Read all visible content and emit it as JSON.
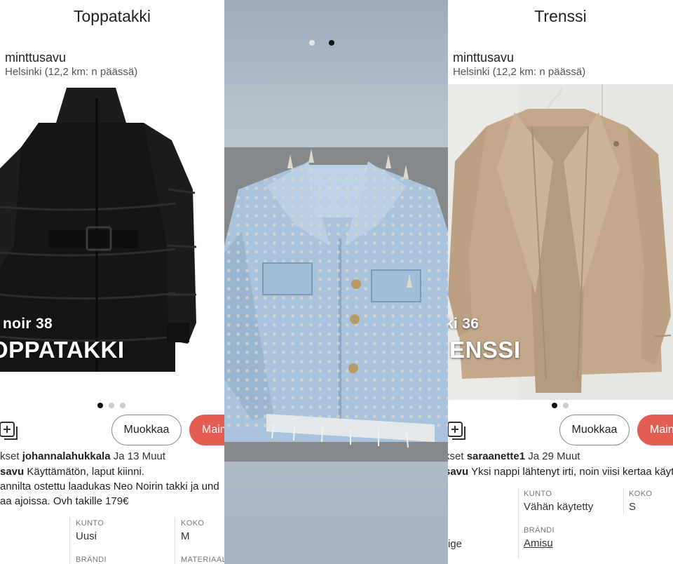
{
  "left": {
    "title": "Toppatakki",
    "seller": "minttusavu",
    "location": "Helsinki (12,2 km: n päässä)",
    "overlay_line1": "noir 38",
    "overlay_line2": "OPPATAKKI",
    "edit_label": "Muokkaa",
    "promote_label": "Main",
    "likes_prefix": "kset",
    "liker": "johannalahukkala",
    "likes_suffix": "Ja 13 Muut",
    "desc_user": "savu",
    "desc_line1": "Käyttämätön, laput kiinni.",
    "desc_line2": "annilta ostettu laadukas Neo Noirin takki ja und",
    "desc_line3": "aa ajoissa. Ovh takille 179€",
    "specs": {
      "condition_label": "KUNTO",
      "condition": "Uusi",
      "size_label": "KOKO",
      "size": "M",
      "brand_label": "BRÄNDI",
      "material_label": "MATERIAAL"
    }
  },
  "middle": {
    "image_alt": "studded denim jacket"
  },
  "right": {
    "title": "Trenssi",
    "seller": "minttusavu",
    "location": "Helsinki (12,2 km: n päässä)",
    "overlay_line1": "ki 36",
    "overlay_line2": "ENSSI",
    "edit_label": "Muokkaa",
    "promote_label": "Main",
    "likes_prefix": "kset",
    "liker": "saraanette1",
    "likes_suffix": "Ja 29 Muut",
    "desc_user": "savu",
    "desc_line1": "Yksi nappi lähtenyt irti, noin viisi kertaa käyt",
    "specs": {
      "condition_label": "KUNTO",
      "condition": "Vähän käytetty",
      "size_label": "KOKO",
      "size": "S",
      "brand_label": "BRÄNDI",
      "brand": "Amisu",
      "partial": "ige"
    }
  },
  "colors": {
    "accent": "#e35d53",
    "dot_active": "#111111",
    "dot_inactive": "#cccccc"
  }
}
